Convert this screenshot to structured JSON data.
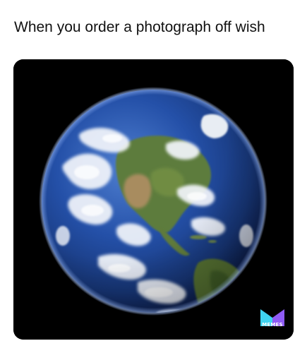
{
  "caption": "When you order a photograph off wish",
  "image": {
    "subject": "earth-globe"
  },
  "watermark": {
    "text": "MEMES",
    "colors": {
      "left": "#3fd3f0",
      "right": "#8f5bf5"
    }
  },
  "colors": {
    "background": "#ffffff",
    "card": "#000000",
    "ocean": "#1d3f8e",
    "land": "#5b7a3a",
    "desert": "#b49466",
    "cloud": "#f2f5fa"
  }
}
